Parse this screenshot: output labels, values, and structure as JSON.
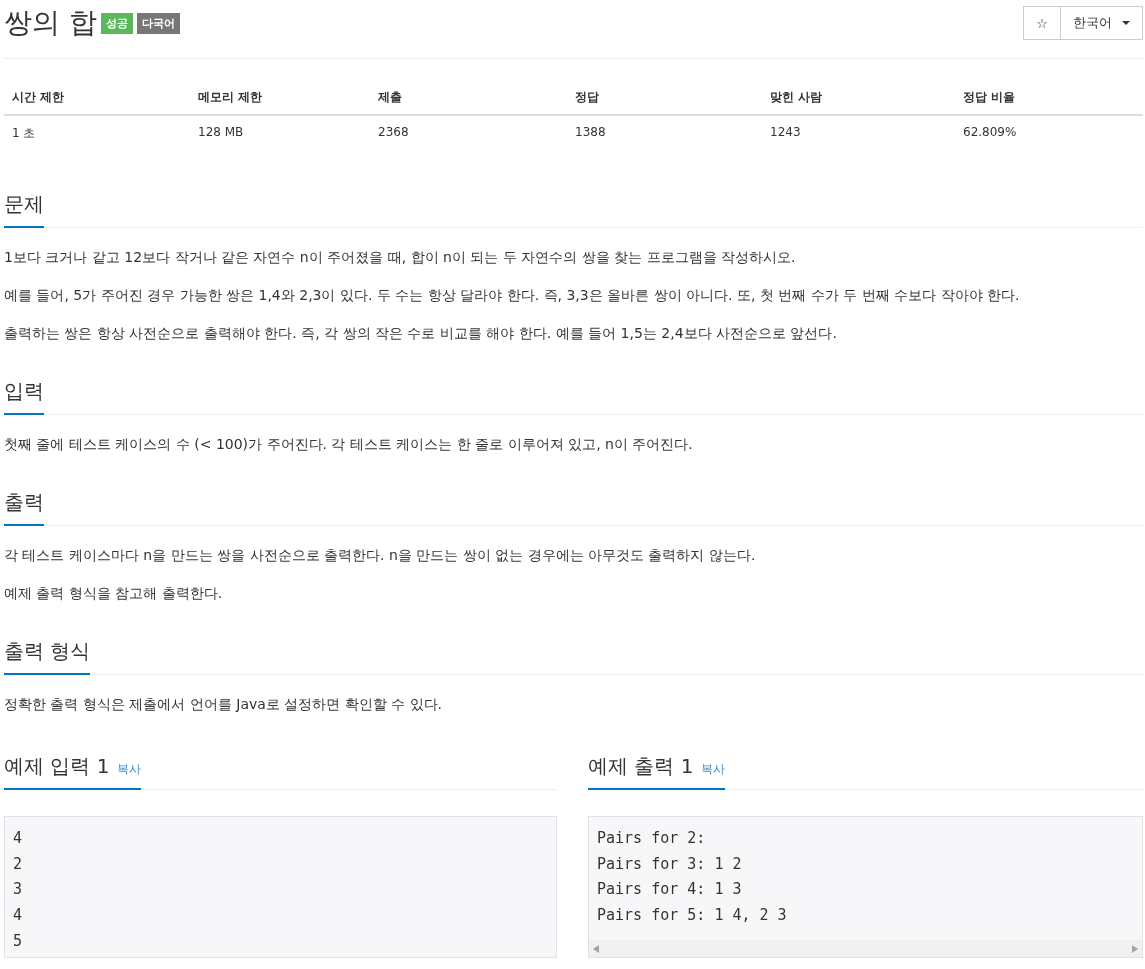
{
  "title": "쌍의 합",
  "badges": [
    {
      "label": "성공",
      "color": "#5cb85c"
    },
    {
      "label": "다국어",
      "color": "#777777"
    }
  ],
  "star_button": {
    "label": "☆"
  },
  "language_menu": {
    "label": "한국어"
  },
  "stats": {
    "columns": [
      "시간 제한",
      "메모리 제한",
      "제출",
      "정답",
      "맞힌 사람",
      "정답 비율"
    ],
    "row": [
      "1 초",
      "128 MB",
      "2368",
      "1388",
      "1243",
      "62.809%"
    ]
  },
  "sections": [
    {
      "heading": "문제",
      "paragraphs": [
        "1보다 크거나 같고 12보다 작거나 같은 자연수 n이 주어졌을 때, 합이 n이 되는 두 자연수의 쌍을 찾는 프로그램을 작성하시오.",
        "예를 들어, 5가 주어진 경우 가능한 쌍은 1,4와 2,3이 있다. 두 수는 항상 달라야 한다. 즉, 3,3은 올바른 쌍이 아니다. 또, 첫 번째 수가 두 번째 수보다 작아야 한다.",
        "출력하는 쌍은 항상 사전순으로 출력해야 한다. 즉, 각 쌍의 작은 수로 비교를 해야 한다. 예를 들어 1,5는 2,4보다 사전순으로 앞선다."
      ]
    },
    {
      "heading": "입력",
      "paragraphs": [
        "첫째 줄에 테스트 케이스의 수 (< 100)가 주어진다. 각 테스트 케이스는 한 줄로 이루어져 있고, n이 주어진다."
      ]
    },
    {
      "heading": "출력",
      "paragraphs": [
        "각 테스트 케이스마다 n을 만드는 쌍을 사전순으로 출력한다. n을 만드는 쌍이 없는 경우에는 아무것도 출력하지 않는다.",
        "예제 출력 형식을 참고해 출력한다."
      ]
    },
    {
      "heading": "출력 형식",
      "paragraphs": [
        "정확한 출력 형식은 제출에서 언어를 Java로 설정하면 확인할 수 있다."
      ]
    }
  ],
  "samples": [
    {
      "heading": "예제 입력 1",
      "copy": "복사",
      "lines": [
        "4",
        "2",
        "3",
        "4",
        "5"
      ]
    },
    {
      "heading": "예제 출력 1",
      "copy": "복사",
      "lines": [
        "Pairs for 2:",
        "Pairs for 3: 1 2",
        "Pairs for 4: 1 3",
        "Pairs for 5: 1 4, 2 3"
      ]
    }
  ]
}
